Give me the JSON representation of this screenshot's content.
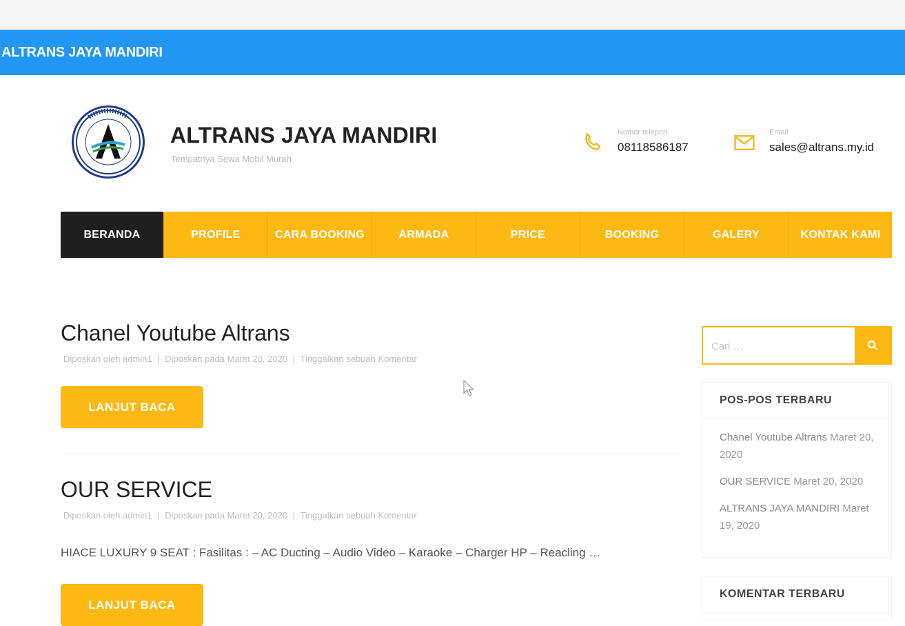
{
  "topbar": {
    "title": "ALTRANS JAYA MANDIRI"
  },
  "header": {
    "site_title": "ALTRANS JAYA MANDIRI",
    "tagline": "Tempatnya Sewa Mobil Murah",
    "phone": {
      "label": "Nomor telepon",
      "value": "08118586187"
    },
    "email": {
      "label": "Email",
      "value": "sales@altrans.my.id"
    },
    "logo_text": "PT. ALTRANS JAYA MANDIRI"
  },
  "nav": {
    "items": [
      {
        "label": "BERANDA"
      },
      {
        "label": "PROFILE"
      },
      {
        "label": "CARA BOOKING"
      },
      {
        "label": "ARMADA"
      },
      {
        "label": "PRICE"
      },
      {
        "label": "BOOKING"
      },
      {
        "label": "GALERY"
      },
      {
        "label": "KONTAK KAMI"
      }
    ]
  },
  "posts": [
    {
      "title": "Chanel Youtube Altrans",
      "author": "Diposkan oleh admin1",
      "date": "Diposkan pada Maret 20, 2020",
      "comment": "Tinggalkan sebuah Komentar",
      "button": "LANJUT BACA"
    },
    {
      "title": "OUR SERVICE",
      "author": "Diposkan oleh admin1",
      "date": "Diposkan pada Maret 20, 2020",
      "comment": "Tinggalkan sebuah Komentar",
      "excerpt": "HIACE LUXURY 9 SEAT : Fasilitas : – AC Ducting – Audio Video – Karaoke – Charger HP – Reacling …",
      "button": "LANJUT BACA"
    }
  ],
  "meta_separator": "|",
  "sidebar": {
    "search": {
      "placeholder": "Cari …"
    },
    "recent_posts": {
      "title": "POS-POS TERBARU",
      "items": [
        {
          "title": "Chanel Youtube Altrans",
          "date": "Maret 20, 2020"
        },
        {
          "title": "OUR SERVICE",
          "date": "Maret 20, 2020"
        },
        {
          "title": "ALTRANS JAYA MANDIRI",
          "date": "Maret 19, 2020"
        }
      ]
    },
    "recent_comments": {
      "title": "KOMENTAR TERBARU"
    }
  },
  "colors": {
    "blue": "#2196f3",
    "accent": "#fdb813",
    "active_nav": "#1f1f1f"
  }
}
